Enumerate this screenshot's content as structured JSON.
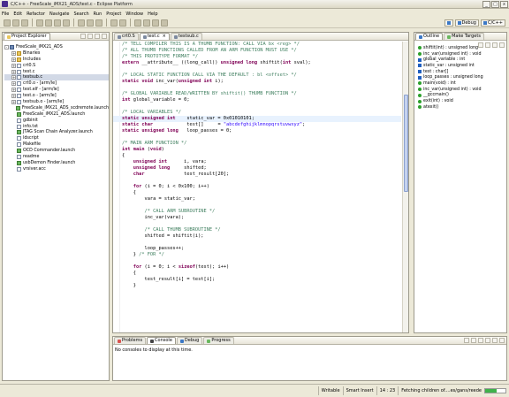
{
  "window": {
    "title": "C/C++ - FreeScale_iMX21_ADS/test.c - Eclipse Platform",
    "controls": [
      "_",
      "□",
      "x"
    ]
  },
  "menu": [
    "File",
    "Edit",
    "Refactor",
    "Navigate",
    "Search",
    "Run",
    "Project",
    "Window",
    "Help"
  ],
  "perspectives": [
    {
      "label": "Debug",
      "icon": "debug-icon"
    },
    {
      "label": "C/C++",
      "icon": "cpp-icon"
    }
  ],
  "project_explorer": {
    "tab": "Project Explorer",
    "items": [
      {
        "depth": 0,
        "expand": "-",
        "icon": "proj",
        "label": "FreeScale_iMX21_ADS"
      },
      {
        "depth": 1,
        "expand": "+",
        "icon": "fold",
        "label": "Binaries"
      },
      {
        "depth": 1,
        "expand": "+",
        "icon": "fold",
        "label": "Includes"
      },
      {
        "depth": 1,
        "expand": "+",
        "icon": "file",
        "label": "crt0.S"
      },
      {
        "depth": 1,
        "expand": "+",
        "icon": "file",
        "label": "test.c"
      },
      {
        "depth": 1,
        "expand": "+",
        "icon": "file",
        "label": "testsub.c",
        "selected": true
      },
      {
        "depth": 1,
        "expand": "+",
        "icon": "file",
        "label": "crt0.o - [arm/le]"
      },
      {
        "depth": 1,
        "expand": "+",
        "icon": "file",
        "label": "test.elf - [arm/le]"
      },
      {
        "depth": 1,
        "expand": "+",
        "icon": "file",
        "label": "test.o - [arm/le]"
      },
      {
        "depth": 1,
        "expand": "+",
        "icon": "file",
        "label": "testsub.o - [arm/le]"
      },
      {
        "depth": 1,
        "expand": "",
        "icon": "launch",
        "label": "FreeScale_iMX21_ADS_scdremote.launch"
      },
      {
        "depth": 1,
        "expand": "",
        "icon": "launch",
        "label": "FreeScale_iMX21_ADS.launch"
      },
      {
        "depth": 1,
        "expand": "",
        "icon": "file",
        "label": "gdbinit"
      },
      {
        "depth": 1,
        "expand": "",
        "icon": "file",
        "label": "info.txt"
      },
      {
        "depth": 1,
        "expand": "",
        "icon": "launch",
        "label": "JTAG Scan Chain Analyzer.launch"
      },
      {
        "depth": 1,
        "expand": "",
        "icon": "file",
        "label": "ldscript"
      },
      {
        "depth": 1,
        "expand": "",
        "icon": "file",
        "label": "Makefile"
      },
      {
        "depth": 1,
        "expand": "",
        "icon": "launch",
        "label": "OCD Commander.launch"
      },
      {
        "depth": 1,
        "expand": "",
        "icon": "file",
        "label": "readme"
      },
      {
        "depth": 1,
        "expand": "",
        "icon": "launch",
        "label": "usbDemon Finder.launch"
      },
      {
        "depth": 1,
        "expand": "",
        "icon": "file",
        "label": "vrsiver.acc"
      }
    ]
  },
  "editor": {
    "tabs": [
      {
        "label": "crt0.S",
        "active": false
      },
      {
        "label": "test.c",
        "active": true,
        "closable": true
      },
      {
        "label": "testsub.c",
        "active": false
      }
    ],
    "lines": [
      [
        [
          "cmt",
          "/* TELL COMPILER THIS IS A THUMB FUNCTION: CALL VIA bx <reg> */"
        ]
      ],
      [
        [
          "cmt",
          "/* ALL THUMB FUNCTIONS CALLED FROM AN ARM FUNCTION MUST USE */"
        ]
      ],
      [
        [
          "cmt",
          "/* THIS PROTOTYPE FORMAT */"
        ]
      ],
      [
        [
          "kw",
          "extern"
        ],
        [
          "",
          " __attribute__ ((long_call)) "
        ],
        [
          "kw",
          "unsigned long"
        ],
        [
          "",
          " shiftit("
        ],
        [
          "kw",
          "int"
        ],
        [
          "",
          " sval);"
        ]
      ],
      [
        [
          "",
          ""
        ]
      ],
      [
        [
          "cmt",
          "/* LOCAL STATIC FUNCTION CALL VIA THE DEFAULT : bl <offset> */"
        ]
      ],
      [
        [
          "kw",
          "static void"
        ],
        [
          "",
          " inc_var("
        ],
        [
          "kw",
          "unsigned int"
        ],
        [
          "",
          " i);"
        ]
      ],
      [
        [
          "",
          ""
        ]
      ],
      [
        [
          "cmt",
          "/* GLOBAL VARIABLE READ/WRITTEN BY shiftit() THUMB FUNCTION */"
        ]
      ],
      [
        [
          "kw",
          "int"
        ],
        [
          "",
          " global_variable = 0;"
        ]
      ],
      [
        [
          "",
          ""
        ]
      ],
      [
        [
          "cmt",
          "/* LOCAL VARIABLES */"
        ]
      ],
      [
        [
          "kw",
          "static unsigned int"
        ],
        [
          "",
          "    static_var = 0x01010101;"
        ]
      ],
      [
        [
          "kw",
          "static char"
        ],
        [
          "",
          "            test[]     = "
        ],
        [
          "str",
          "\"abcdefghijklmnopqrstuvwxyz\""
        ],
        [
          "",
          ";"
        ]
      ],
      [
        [
          "kw",
          "static unsigned long"
        ],
        [
          "",
          "   loop_passes = 0;"
        ]
      ],
      [
        [
          "",
          ""
        ]
      ],
      [
        [
          "cmt",
          "/* MAIN ARM FUNCTION */"
        ]
      ],
      [
        [
          "kw",
          "int main"
        ],
        [
          "",
          " ("
        ],
        [
          "kw",
          "void"
        ],
        [
          "",
          ")"
        ]
      ],
      [
        [
          "",
          "{"
        ]
      ],
      [
        [
          "",
          "    "
        ],
        [
          "kw",
          "unsigned int"
        ],
        [
          "",
          "      i, vara;"
        ]
      ],
      [
        [
          "",
          "    "
        ],
        [
          "kw",
          "unsigned long"
        ],
        [
          "",
          "     shifted;"
        ]
      ],
      [
        [
          "",
          "    "
        ],
        [
          "kw",
          "char"
        ],
        [
          "",
          "              test_result[20];"
        ]
      ],
      [
        [
          "",
          ""
        ]
      ],
      [
        [
          "",
          "    "
        ],
        [
          "kw",
          "for"
        ],
        [
          "",
          " (i = 0; i < 0x100; i++)"
        ]
      ],
      [
        [
          "",
          "    {"
        ]
      ],
      [
        [
          "",
          "        vara = static_var;"
        ]
      ],
      [
        [
          "",
          ""
        ]
      ],
      [
        [
          "",
          "        "
        ],
        [
          "cmt",
          "/* CALL ARM SUBROUTINE */"
        ]
      ],
      [
        [
          "",
          "        inc_var(vara);"
        ]
      ],
      [
        [
          "",
          ""
        ]
      ],
      [
        [
          "",
          "        "
        ],
        [
          "cmt",
          "/* CALL THUMB SUBROUTINE */"
        ]
      ],
      [
        [
          "",
          "        shifted = shiftit(i);"
        ]
      ],
      [
        [
          "",
          ""
        ]
      ],
      [
        [
          "",
          "        loop_passes++;"
        ]
      ],
      [
        [
          "",
          "    } "
        ],
        [
          "cmt",
          "/* FOR */"
        ]
      ],
      [
        [
          "",
          ""
        ]
      ],
      [
        [
          "",
          "    "
        ],
        [
          "kw",
          "for"
        ],
        [
          "",
          " (i = 0; i < "
        ],
        [
          "kw",
          "sizeof"
        ],
        [
          "",
          "(test); i++)"
        ]
      ],
      [
        [
          "",
          "    {"
        ]
      ],
      [
        [
          "",
          "        test_result[i] = test[i];"
        ]
      ],
      [
        [
          "",
          "    }"
        ]
      ],
      [
        [
          "",
          ""
        ]
      ]
    ],
    "highlight_line": 12
  },
  "outline": {
    "tabs": [
      {
        "label": "Outline",
        "active": true
      },
      {
        "label": "Make Targets",
        "active": false
      }
    ],
    "items": [
      {
        "kind": "g",
        "label": "shiftit(int) : unsigned long"
      },
      {
        "kind": "g",
        "label": "inc_var(unsigned int) : void"
      },
      {
        "kind": "b",
        "label": "global_variable : int"
      },
      {
        "kind": "b",
        "label": "static_var : unsigned int"
      },
      {
        "kind": "b",
        "label": "test : char[]"
      },
      {
        "kind": "b",
        "label": "loop_passes : unsigned long"
      },
      {
        "kind": "g",
        "label": "main(void) : int"
      },
      {
        "kind": "g",
        "label": "inc_var(unsigned int) : void"
      },
      {
        "kind": "g",
        "label": "__gccmain()"
      },
      {
        "kind": "g",
        "label": "exit(int) : void"
      },
      {
        "kind": "g",
        "label": "atexit()"
      }
    ]
  },
  "console": {
    "tabs": [
      {
        "label": "Problems",
        "active": false
      },
      {
        "label": "Console",
        "active": true
      },
      {
        "label": "Debug",
        "active": false
      },
      {
        "label": "Progress",
        "active": false
      }
    ],
    "message": "No consoles to display at this time."
  },
  "status": {
    "mode": "Writable",
    "insert": "Smart Insert",
    "position": "14 : 23",
    "task": "Fetching children of....es/gans/reede",
    "progress": 0.55
  }
}
